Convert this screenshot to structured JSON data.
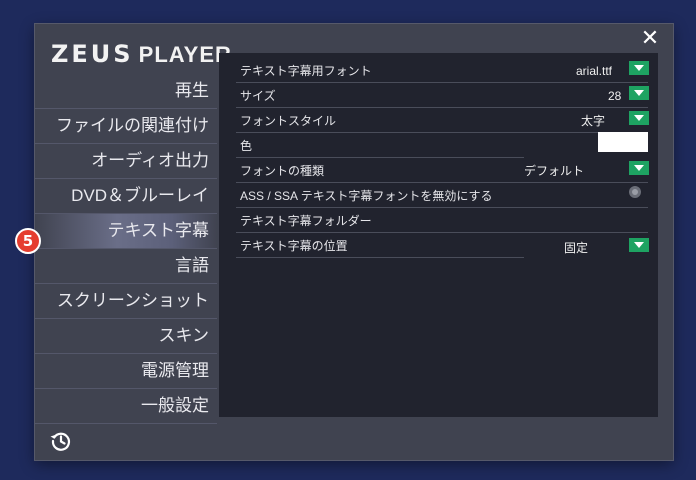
{
  "app": {
    "logo_brand": "ZEUS",
    "logo_product": "PLAYER"
  },
  "window": {
    "close_icon": "close-icon"
  },
  "sidebar": {
    "items": [
      {
        "label": "再生"
      },
      {
        "label": "ファイルの関連付け"
      },
      {
        "label": "オーディオ出力"
      },
      {
        "label": "DVD＆ブルーレイ"
      },
      {
        "label": "テキスト字幕",
        "active": true
      },
      {
        "label": "言語"
      },
      {
        "label": "スクリーンショット"
      },
      {
        "label": "スキン"
      },
      {
        "label": "電源管理"
      },
      {
        "label": "一般設定"
      }
    ],
    "footer_icon": "history-icon"
  },
  "step_badge": "5",
  "settings": {
    "font": {
      "label": "テキスト字幕用フォント",
      "value": "arial.ttf"
    },
    "size": {
      "label": "サイズ",
      "value": "28"
    },
    "style": {
      "label": "フォントスタイル",
      "value": "太字"
    },
    "color": {
      "label": "色",
      "value": "#ffffff"
    },
    "font_type": {
      "label": "フォントの種類",
      "value": "デフォルト"
    },
    "disable_ass": {
      "label": "ASS / SSA テキスト字幕フォントを無効にする",
      "checked": false
    },
    "folder": {
      "label": "テキスト字幕フォルダー"
    },
    "position": {
      "label": "テキスト字幕の位置",
      "value": "固定"
    }
  },
  "colors": {
    "background": "#1e2a5c",
    "dialog": "#404350",
    "panel": "#21232e",
    "accent": "#1ea362",
    "badge": "#e53d2f"
  }
}
